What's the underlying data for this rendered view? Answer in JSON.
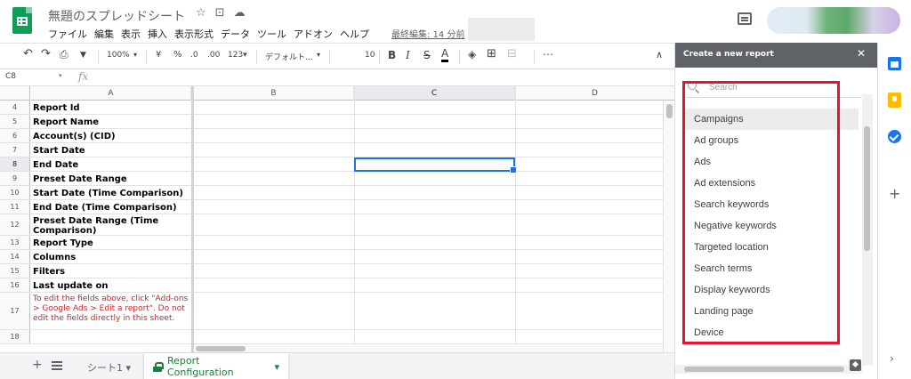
{
  "app": {
    "doc_title": "無題のスプレッドシート",
    "title_icons": [
      "☆",
      "⊡",
      "☁"
    ],
    "menu": [
      "ファイル",
      "編集",
      "表示",
      "挿入",
      "表示形式",
      "データ",
      "ツール",
      "アドオン",
      "ヘルプ"
    ],
    "last_edit": "最終編集: 14 分前"
  },
  "toolbar": {
    "undo": "↶",
    "redo": "↷",
    "print": "⎙",
    "paint": "▼",
    "zoom": "100%",
    "zoom_caret": "▾",
    "currency": "¥",
    "percent": "%",
    "dec_less": ".0",
    "dec_more": ".00",
    "more_formats": "123▾",
    "font": "デフォルト...",
    "font_caret": "▾",
    "font_size": "10",
    "size_caret": "▾",
    "bold": "B",
    "italic": "I",
    "strike": "S",
    "text_color": "A",
    "fill": "◈",
    "borders": "⊞",
    "merge": "⊟",
    "more": "⋯",
    "collapse": "∧"
  },
  "formula": {
    "cell_ref": "C8",
    "name_caret": "▾",
    "fx": "fx"
  },
  "grid": {
    "columns": [
      "A",
      "B",
      "C",
      "D"
    ],
    "rows": [
      {
        "num": "4",
        "a": "Report Id"
      },
      {
        "num": "5",
        "a": "Report Name"
      },
      {
        "num": "6",
        "a": "Account(s) (CID)"
      },
      {
        "num": "7",
        "a": "Start Date"
      },
      {
        "num": "8",
        "a": "End Date"
      },
      {
        "num": "9",
        "a": "Preset Date Range"
      },
      {
        "num": "10",
        "a": "Start Date (Time Comparison)"
      },
      {
        "num": "11",
        "a": "End Date (Time Comparison)"
      },
      {
        "num": "12",
        "a": "Preset Date Range (Time Comparison)"
      },
      {
        "num": "13",
        "a": "Report Type"
      },
      {
        "num": "14",
        "a": "Columns"
      },
      {
        "num": "15",
        "a": "Filters"
      },
      {
        "num": "16",
        "a": "Last update on"
      },
      {
        "num": "17",
        "a": "To edit the fields above, click \"Add-ons > Google Ads > Edit a report\". Do not edit the fields directly in this sheet."
      },
      {
        "num": "18",
        "a": ""
      }
    ]
  },
  "sheets": {
    "add": "+",
    "tab1": "シート1 ▾",
    "tab2": "Report Configuration",
    "tab2_caret": "▾"
  },
  "panel": {
    "title": "Create a new report",
    "close": "✕",
    "search_placeholder": "Search",
    "items": [
      "Campaigns",
      "Ad groups",
      "Ads",
      "Ad extensions",
      "Search keywords",
      "Negative keywords",
      "Targeted location",
      "Search terms",
      "Display keywords",
      "Landing page",
      "Device"
    ]
  },
  "rail": {
    "plus": "+",
    "chevron": "›"
  },
  "colors": {
    "accent": "#1a73e8",
    "sheet_green": "#188038",
    "highlight_red": "#e8132a",
    "panel_header": "#5f6368",
    "note_red": "#c62828"
  }
}
